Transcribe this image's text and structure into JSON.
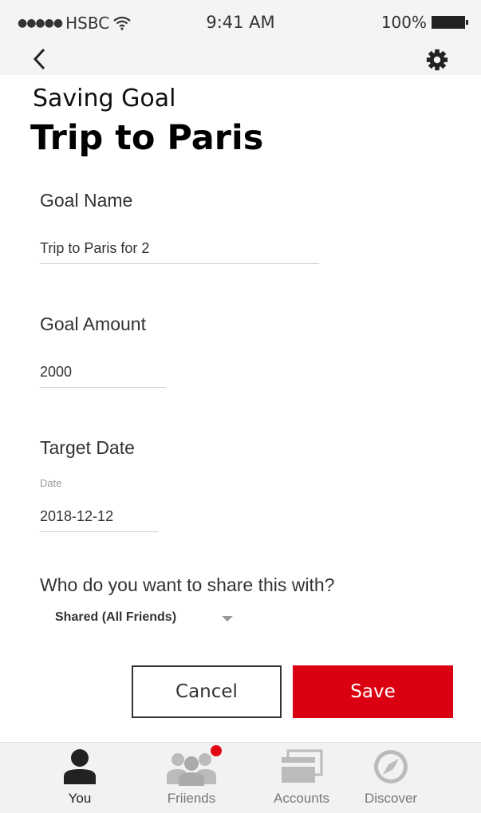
{
  "status_bar": {
    "carrier": "HSBC",
    "signal_dots": "●●●●●",
    "time": "9:41 AM",
    "battery": "100%",
    "icons": [
      "wifi-icon",
      "battery-icon"
    ]
  },
  "nav": {
    "icons": [
      "back-icon",
      "gear-icon"
    ]
  },
  "header": {
    "subtitle": "Saving Goal",
    "title": "Trip to Paris"
  },
  "form": {
    "goal_name": {
      "label": "Goal Name",
      "value": "Trip to Paris for 2"
    },
    "goal_amount": {
      "label": "Goal Amount",
      "value": "2000"
    },
    "target_date": {
      "label": "Target Date",
      "hint": "Date",
      "value": "2018-12-12"
    },
    "share": {
      "label": "Who do you want to share this with?",
      "selected": "Shared (All Friends)"
    }
  },
  "actions": {
    "cancel_label": "Cancel",
    "save_label": "Save"
  },
  "tabs": [
    {
      "label": "You",
      "icon": "person-icon",
      "active": true
    },
    {
      "label": "Friiends",
      "icon": "group-icon",
      "active": false,
      "notification": true
    },
    {
      "label": "Accounts",
      "icon": "card-icon",
      "active": false
    },
    {
      "label": "Discover",
      "icon": "compass-icon",
      "active": false
    }
  ],
  "colors": {
    "brand_red": "#db0011",
    "notification_red": "#e30613",
    "bar_background": "#f4f4f4"
  }
}
